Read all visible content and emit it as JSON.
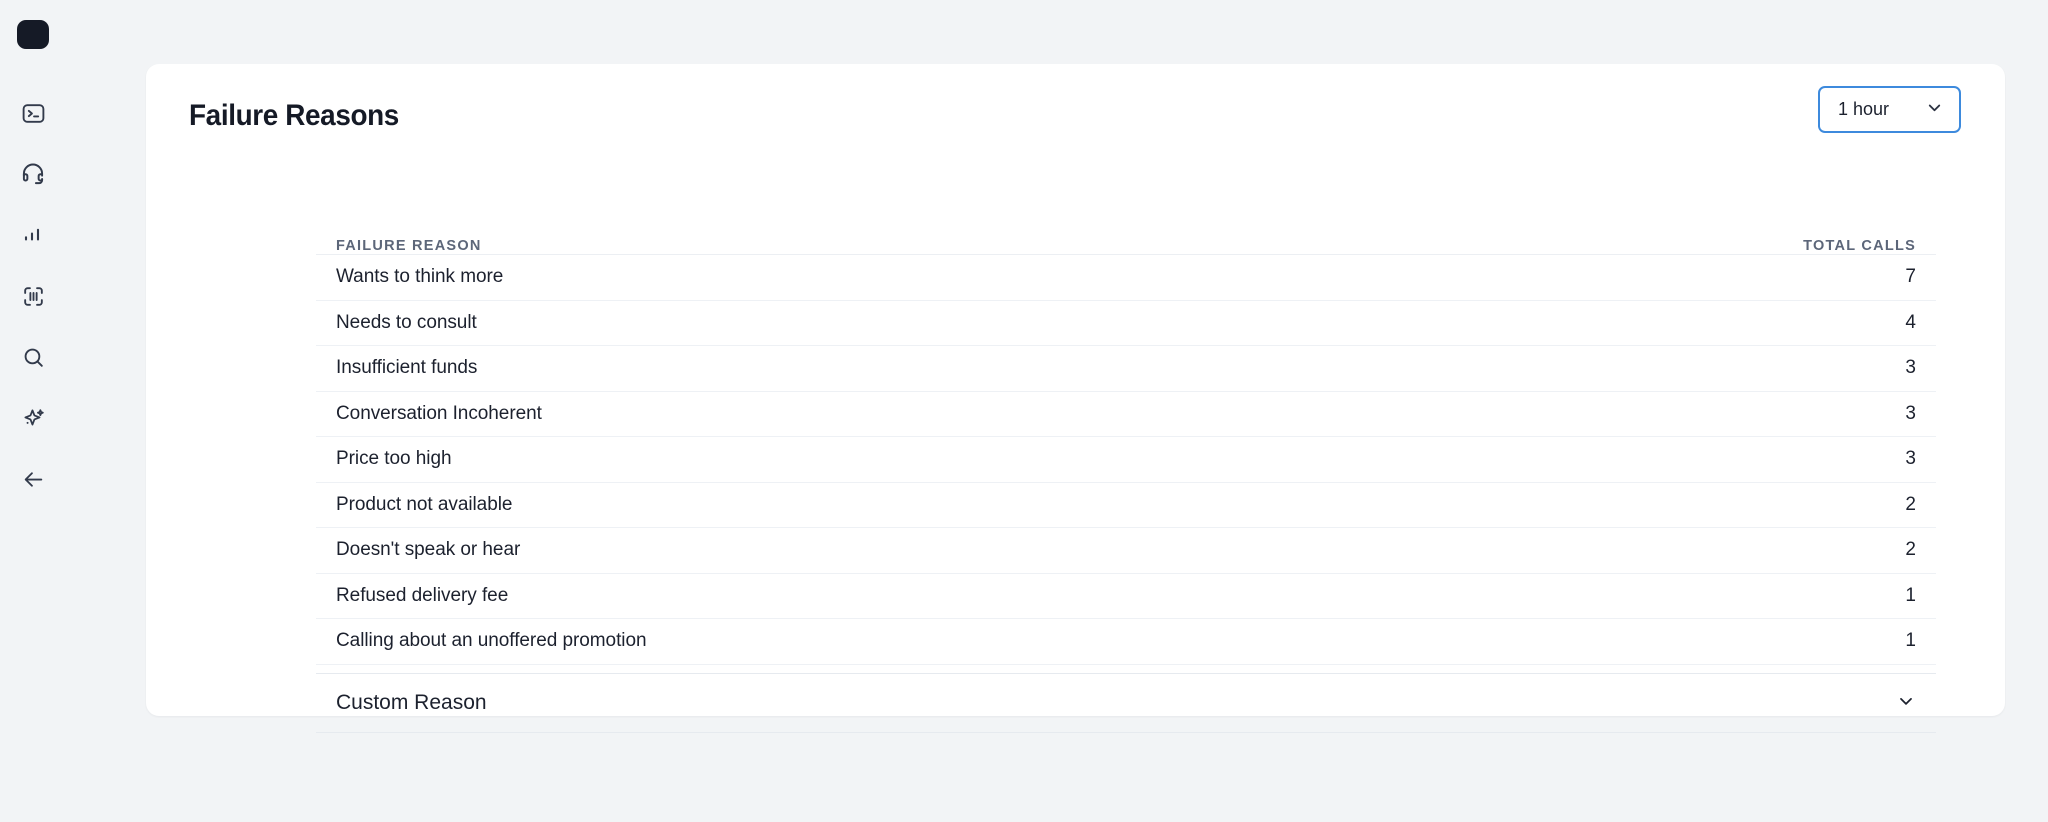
{
  "sidebar": {
    "logo_name": "app-logo",
    "items": [
      {
        "icon": "terminal-icon",
        "name": "sidebar-item-terminal"
      },
      {
        "icon": "headset-icon",
        "name": "sidebar-item-calls"
      },
      {
        "icon": "bar-chart-icon",
        "name": "sidebar-item-analytics"
      },
      {
        "icon": "scan-icon",
        "name": "sidebar-item-scan"
      },
      {
        "icon": "search-icon",
        "name": "sidebar-item-search"
      },
      {
        "icon": "sparkles-icon",
        "name": "sidebar-item-ai"
      },
      {
        "icon": "arrow-left-icon",
        "name": "sidebar-item-back"
      }
    ]
  },
  "card": {
    "title": "Failure Reasons",
    "range_select": {
      "value": "1 hour",
      "icon": "chevron-down-icon"
    },
    "table": {
      "columns": [
        "FAILURE REASON",
        "TOTAL CALLS"
      ],
      "rows": [
        {
          "reason": "Wants to think more",
          "calls": "7"
        },
        {
          "reason": "Needs to consult",
          "calls": "4"
        },
        {
          "reason": "Insufficient funds",
          "calls": "3"
        },
        {
          "reason": "Conversation Incoherent",
          "calls": "3"
        },
        {
          "reason": "Price too high",
          "calls": "3"
        },
        {
          "reason": "Product not available",
          "calls": "2"
        },
        {
          "reason": "Doesn't speak or hear",
          "calls": "2"
        },
        {
          "reason": "Refused delivery fee",
          "calls": "1"
        },
        {
          "reason": "Calling about an unoffered promotion",
          "calls": "1"
        }
      ]
    },
    "custom_reason": {
      "label": "Custom Reason",
      "icon": "chevron-down-icon"
    }
  },
  "colors": {
    "page_background": "#f2f4f6",
    "card_background": "#ffffff",
    "accent_border": "#3d8add",
    "text_primary": "#1c212e",
    "text_muted": "#5c6679",
    "divider": "#eef1f5",
    "logo": "#151a26"
  }
}
